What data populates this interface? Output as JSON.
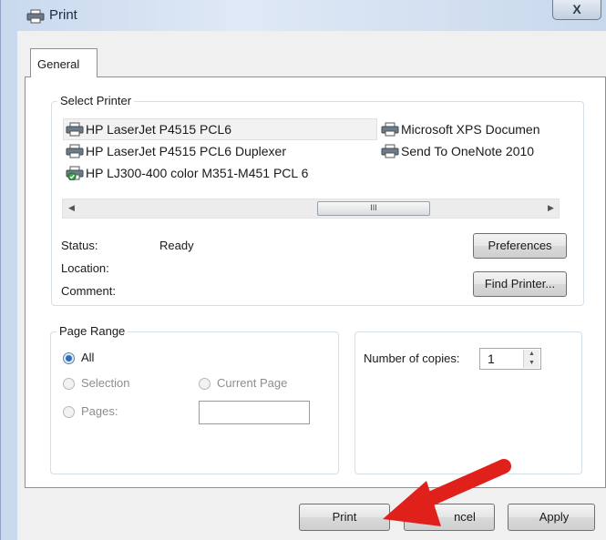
{
  "window": {
    "title": "Print",
    "close_label": "X"
  },
  "tabs": [
    {
      "label": "General"
    }
  ],
  "select_printer": {
    "legend": "Select Printer",
    "printers": [
      {
        "name": "HP LaserJet P4515 PCL6",
        "icon": "printer-icon",
        "selected": true
      },
      {
        "name": "HP LaserJet P4515 PCL6  Duplexer",
        "icon": "printer-icon"
      },
      {
        "name": "HP LJ300-400 color M351-M451 PCL 6",
        "icon": "printer-default-icon"
      },
      {
        "name": "Microsoft XPS Documen",
        "icon": "printer-icon"
      },
      {
        "name": "Send To OneNote 2010",
        "icon": "printer-icon"
      }
    ],
    "scroll_thumb_grip": "III"
  },
  "status": {
    "status_label": "Status:",
    "status_value": "Ready",
    "location_label": "Location:",
    "comment_label": "Comment:"
  },
  "buttons": {
    "preferences": "Preferences",
    "find_printer": "Find Printer...",
    "print": "Print",
    "cancel": "ncel",
    "apply": "Apply"
  },
  "page_range": {
    "legend": "Page Range",
    "all": "All",
    "selection": "Selection",
    "current_page": "Current Page",
    "pages": "Pages:",
    "pages_value": ""
  },
  "copies": {
    "label": "Number of copies:",
    "value": "1"
  },
  "colors": {
    "annotation_arrow": "#e0201b",
    "radio_selected": "#2a6fb8"
  }
}
